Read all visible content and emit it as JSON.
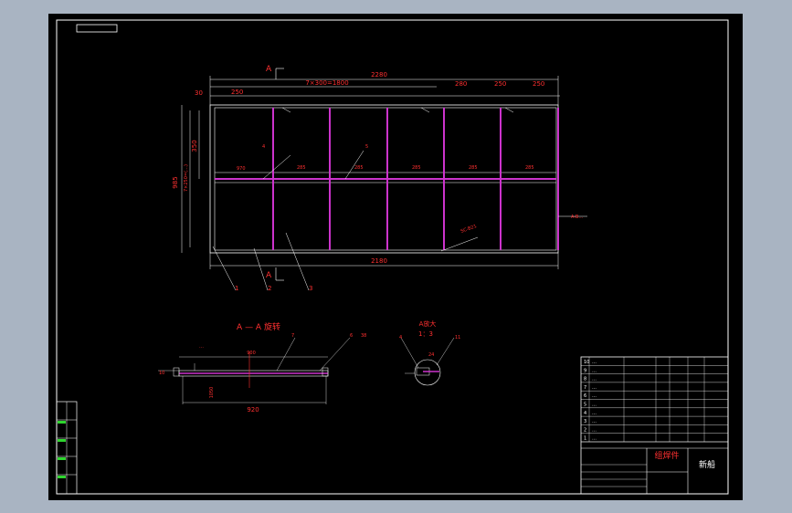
{
  "drawing": {
    "main_view": {
      "section_marker_top": "A",
      "section_marker_bottom": "A",
      "dim_overall_width": "2280",
      "dim_top_chain": "7×300=1800",
      "dim_left_offset": "30",
      "dim_first_bay": "250",
      "dim_right_bays": [
        "280",
        "250",
        "250"
      ],
      "dim_height_total": "985",
      "dim_height_inner": "7×250=(…)",
      "dim_height_half": "350",
      "dim_bottom_width": "2180",
      "dim_bay_labels": [
        "970",
        "285",
        "285",
        "285",
        "285",
        "285"
      ],
      "leader_right": "A-B…",
      "diagonal_note": "SC-B21",
      "callouts": [
        "4",
        "5",
        "1",
        "2",
        "3"
      ]
    },
    "section_view": {
      "title": "A — A 旋转",
      "note_top": "…",
      "dim_width": "920",
      "dim_height": "1050",
      "dim_center": "900",
      "dim_left": "10",
      "callouts": [
        "7",
        "6",
        "38"
      ]
    },
    "detail_view": {
      "title": "A放大",
      "scale": "1：3",
      "callouts": [
        "4",
        "24",
        "11"
      ]
    }
  },
  "title_block": {
    "drawing_name": "组焊件",
    "company": "新船",
    "parts_rows": [
      {
        "no": "10",
        "name": "…",
        "code": "…"
      },
      {
        "no": "9",
        "name": "…",
        "code": "…"
      },
      {
        "no": "8",
        "name": "…",
        "code": "…"
      },
      {
        "no": "7",
        "name": "…",
        "code": "…"
      },
      {
        "no": "6",
        "name": "…",
        "code": "…"
      },
      {
        "no": "5",
        "name": "…",
        "code": "…"
      },
      {
        "no": "4",
        "name": "…",
        "code": "…"
      },
      {
        "no": "3",
        "name": "…",
        "code": "…"
      },
      {
        "no": "2",
        "name": "…",
        "code": "…"
      },
      {
        "no": "1",
        "name": "…",
        "code": "…"
      }
    ]
  },
  "colors": {
    "background": "#000000",
    "frame": "#ffffff",
    "dimension": "#ff3030",
    "member": "#cc33cc",
    "grey": "#a9b4c2"
  }
}
